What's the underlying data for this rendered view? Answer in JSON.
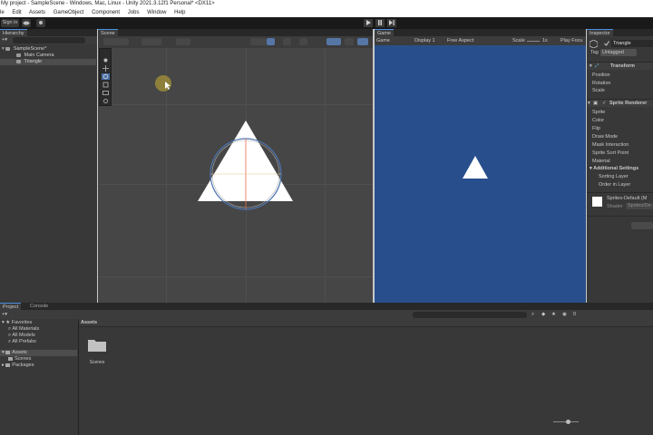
{
  "window": {
    "title": "My project - SampleScene - Windows, Mac, Linux - Unity 2021.3.12f1 Personal* <DX11>"
  },
  "menu": [
    "le",
    "Edit",
    "Assets",
    "GameObject",
    "Component",
    "Jobs",
    "Window",
    "Help"
  ],
  "toolbar": {
    "sign_in": "Sign in",
    "play_icon": "play-icon",
    "pause_icon": "pause-icon",
    "step_icon": "step-icon"
  },
  "hierarchy": {
    "tab": "Hierarchy",
    "scene": "SampleScene*",
    "items": [
      "Main Camera",
      "Triangle"
    ]
  },
  "scene": {
    "tab": "Scene"
  },
  "game": {
    "tab": "Game",
    "mode": "Game",
    "display": "Display 1",
    "aspect": "Free Aspect",
    "scale_label": "Scale",
    "scale_value": "1x",
    "play_focus": "Play Focu"
  },
  "inspector": {
    "tab": "Inspector",
    "object_name": "Triangle",
    "tag_label": "Tag",
    "tag_value": "Untagged",
    "transform": {
      "title": "Transform",
      "rows": [
        "Position",
        "Rotation",
        "Scale"
      ]
    },
    "sprite_renderer": {
      "title": "Sprite Renderer",
      "rows": [
        "Sprite",
        "Color",
        "Flip",
        "Draw Mode",
        "Mask Interaction",
        "Sprite Sort Point",
        "Material"
      ],
      "additional": "Additional Settings",
      "sub_rows": [
        "Sorting Layer",
        "Order in Layer"
      ]
    },
    "material": {
      "name": "Sprites-Default (M",
      "shader_label": "Shader",
      "shader_value": "Sprites/De"
    }
  },
  "project": {
    "tabs": [
      "Project",
      "Console"
    ],
    "favorites": "Favorites",
    "fav_items": [
      "All Materials",
      "All Models",
      "All Prefabs"
    ],
    "assets": "Assets",
    "asset_children": [
      "Scenes"
    ],
    "packages": "Packages",
    "breadcrumb": "Assets",
    "folder_label": "Scenes",
    "hidden_count": "0"
  },
  "colors": {
    "game_bg": "#284f8c",
    "scene_bg": "#464646",
    "accent": "#4a90e2"
  }
}
